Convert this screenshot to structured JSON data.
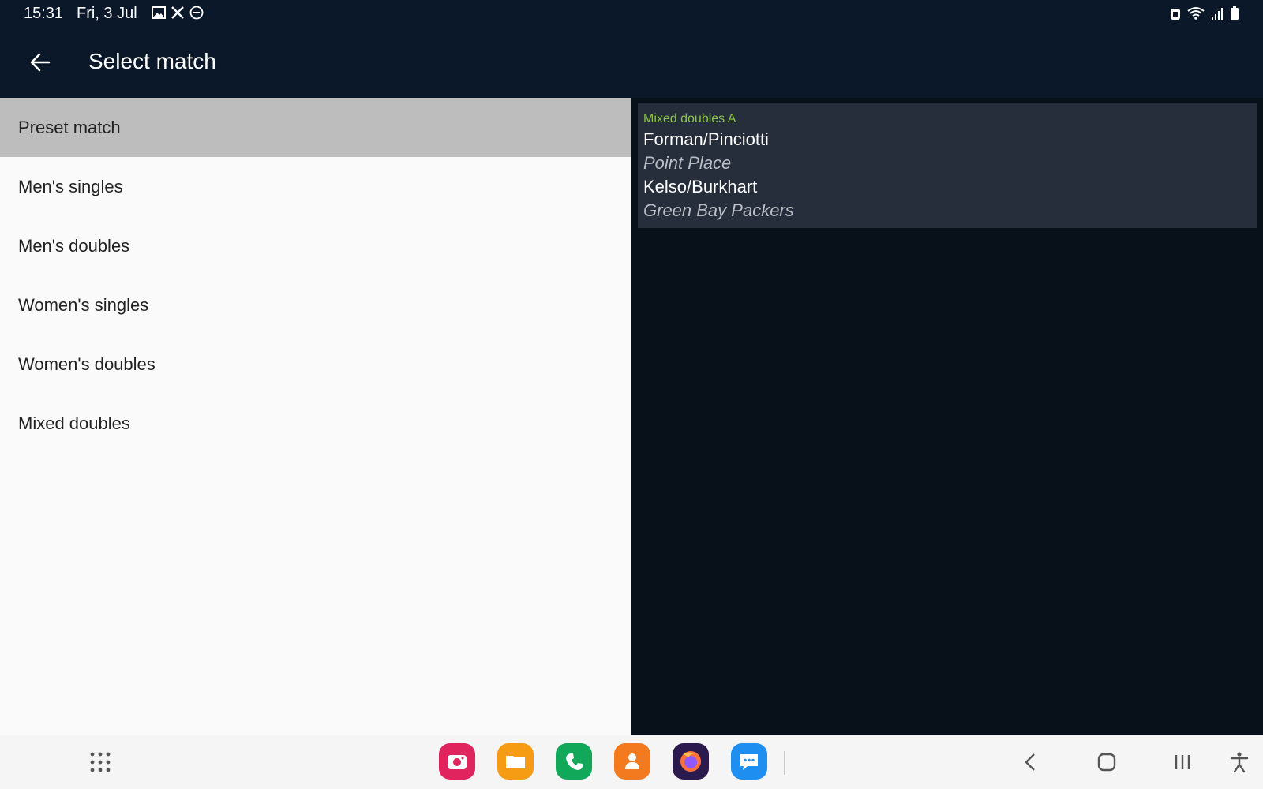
{
  "status_bar": {
    "time": "15:31",
    "date": "Fri, 3 Jul",
    "left_icons": [
      "image-icon",
      "tools-icon",
      "do-not-disturb-icon"
    ],
    "right_icons": [
      "alarm-icon",
      "wifi-icon",
      "signal-icon",
      "battery-icon"
    ]
  },
  "app_bar": {
    "title": "Select match",
    "back_icon": "arrow-left-icon"
  },
  "menu": {
    "items": [
      {
        "label": "Preset match",
        "selected": true
      },
      {
        "label": "Men's singles",
        "selected": false
      },
      {
        "label": "Men's doubles",
        "selected": false
      },
      {
        "label": "Women's singles",
        "selected": false
      },
      {
        "label": "Women's doubles",
        "selected": false
      },
      {
        "label": "Mixed doubles",
        "selected": false
      }
    ]
  },
  "match": {
    "category": "Mixed doubles A",
    "team1": {
      "name": "Forman/Pinciotti",
      "club": "Point Place"
    },
    "team2": {
      "name": "Kelso/Burkhart",
      "club": "Green Bay Packers"
    }
  },
  "colors": {
    "header_bg": "#0b182a",
    "selected_bg": "#bdbdbd",
    "card_bg": "#252e3a",
    "category_green": "#8bc34a",
    "right_panel_bg": "#081019"
  },
  "nav_bar": {
    "apps_icon": "apps-grid-icon",
    "dock": [
      "camera-icon",
      "files-icon",
      "phone-icon",
      "contacts-icon",
      "firefox-icon",
      "messages-icon"
    ],
    "buttons": [
      "back-icon",
      "home-icon",
      "recents-icon",
      "accessibility-icon"
    ]
  }
}
